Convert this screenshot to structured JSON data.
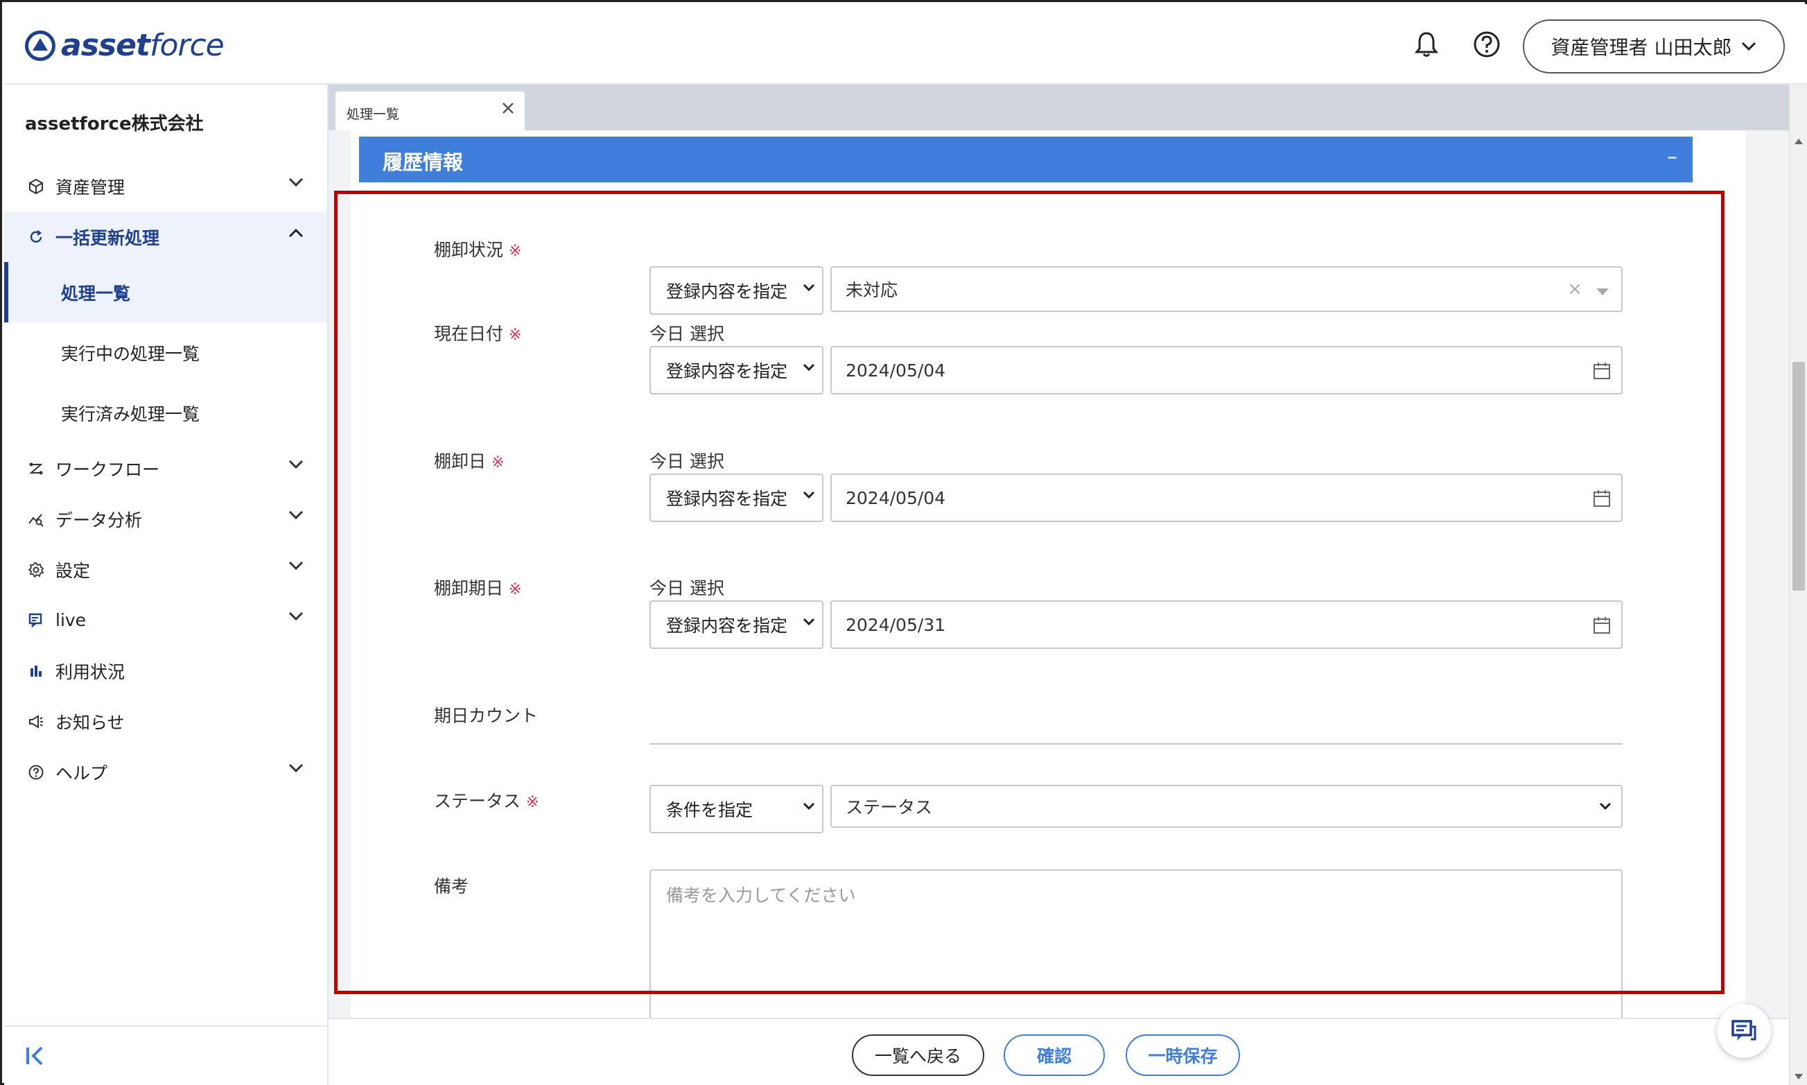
{
  "app": {
    "logo_text_bold": "asset",
    "logo_text_light": "force",
    "user_label": "資産管理者 山田太郎"
  },
  "sidebar": {
    "company": "assetforce株式会社",
    "items": [
      {
        "label": "資産管理",
        "icon": "box-icon"
      },
      {
        "label": "一括更新処理",
        "icon": "refresh-icon"
      },
      {
        "label": "ワークフロー",
        "icon": "workflow-icon"
      },
      {
        "label": "データ分析",
        "icon": "analytics-icon"
      },
      {
        "label": "設定",
        "icon": "gear-icon"
      },
      {
        "label": "live",
        "icon": "live-icon"
      },
      {
        "label": "利用状況",
        "icon": "bar-chart-icon"
      },
      {
        "label": "お知らせ",
        "icon": "megaphone-icon"
      },
      {
        "label": "ヘルプ",
        "icon": "help-icon"
      }
    ],
    "sub_items": [
      "処理一覧",
      "実行中の処理一覧",
      "実行済み処理一覧"
    ]
  },
  "tab": {
    "label": "処理一覧"
  },
  "section": {
    "title": "履歴情報",
    "collapse_symbol": "–"
  },
  "form": {
    "today_label": "今日",
    "select_label": "選択",
    "required_mark": "※",
    "fields": [
      {
        "label": "棚卸状況",
        "mode": "登録内容を指定",
        "value": "未対応"
      },
      {
        "label": "現在日付",
        "mode": "登録内容を指定",
        "value": "2024/05/04"
      },
      {
        "label": "棚卸日",
        "mode": "登録内容を指定",
        "value": "2024/05/04"
      },
      {
        "label": "棚卸期日",
        "mode": "登録内容を指定",
        "value": "2024/05/31"
      },
      {
        "label": "期日カウント"
      },
      {
        "label": "ステータス",
        "mode": "条件を指定",
        "value": "ステータス"
      },
      {
        "label": "備考",
        "placeholder": "備考を入力してください"
      }
    ]
  },
  "footer": {
    "back_label": "一覧へ戻る",
    "confirm_label": "確認",
    "save_label": "一時保存"
  },
  "colors": {
    "brand": "#1f3f8f",
    "section_bar": "#3f7fdb",
    "required": "#d9304f",
    "highlight_border": "#c00000"
  }
}
